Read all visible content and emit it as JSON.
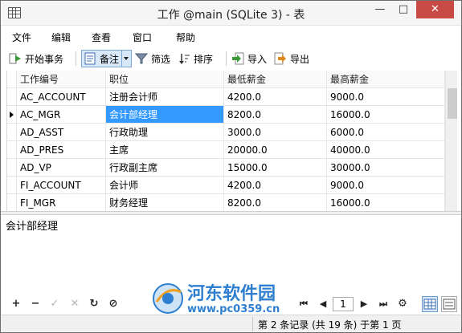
{
  "window": {
    "title": "工作 @main (SQLite 3) - 表",
    "minimize_glyph": "—",
    "maximize_glyph": "□",
    "close_glyph": "✕"
  },
  "menu": {
    "items": [
      "文件",
      "编辑",
      "查看",
      "窗口",
      "帮助"
    ]
  },
  "toolbar": {
    "begin_transaction": "开始事务",
    "memo": "备注",
    "filter": "筛选",
    "sort": "排序",
    "import": "导入",
    "export": "导出"
  },
  "grid": {
    "columns": [
      "工作编号",
      "职位",
      "最低薪金",
      "最高薪金"
    ],
    "rows": [
      [
        "AC_ACCOUNT",
        "注册会计师",
        "4200.0",
        "9000.0"
      ],
      [
        "AC_MGR",
        "会计部经理",
        "8200.0",
        "16000.0"
      ],
      [
        "AD_ASST",
        "行政助理",
        "3000.0",
        "6000.0"
      ],
      [
        "AD_PRES",
        "主席",
        "20000.0",
        "40000.0"
      ],
      [
        "AD_VP",
        "行政副主席",
        "15000.0",
        "30000.0"
      ],
      [
        "FI_ACCOUNT",
        "会计师",
        "4200.0",
        "9000.0"
      ],
      [
        "FI_MGR",
        "财务经理",
        "8200.0",
        "16000.0"
      ]
    ],
    "current_row": 1,
    "selected_cell_col": 1
  },
  "memo": {
    "text": "会计部经理"
  },
  "navigator": {
    "add": "+",
    "delete": "−",
    "apply": "✓",
    "cancel": "✕",
    "refresh": "↻",
    "stop": "⊘",
    "first": "⏮",
    "prev": "◀",
    "page": "1",
    "next": "▶",
    "last": "⏭",
    "settings": "⚙"
  },
  "status": {
    "text": "第 2 条记录 (共 19 条) 于第 1 页"
  },
  "watermark": {
    "name": "河东软件园",
    "url": "www.pc0359.cn"
  },
  "colors": {
    "selection": "#3399ff",
    "close_button": "#c74a45",
    "watermark": "#2f7fd0"
  }
}
